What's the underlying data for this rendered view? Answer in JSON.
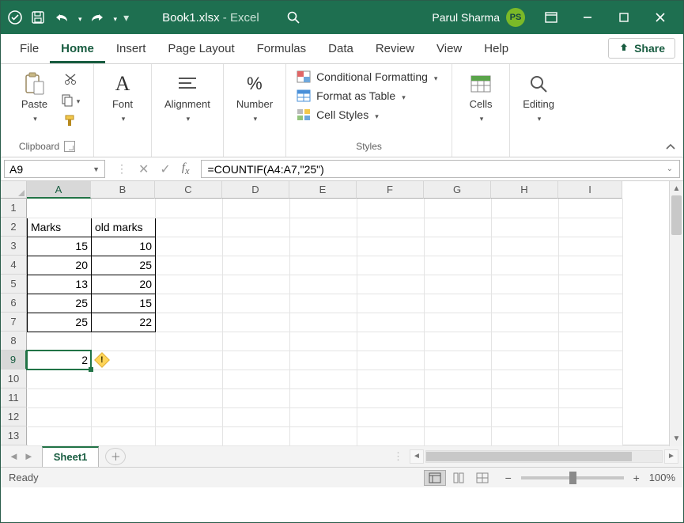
{
  "titlebar": {
    "filename": "Book1.xlsx",
    "app_suffix": " -  Excel",
    "user_name": "Parul Sharma",
    "user_initials": "PS"
  },
  "tabs": {
    "file": "File",
    "home": "Home",
    "insert": "Insert",
    "page_layout": "Page Layout",
    "formulas": "Formulas",
    "data": "Data",
    "review": "Review",
    "view": "View",
    "help": "Help",
    "share": "Share"
  },
  "ribbon": {
    "clipboard": {
      "label": "Clipboard",
      "paste": "Paste"
    },
    "font": {
      "label": "Font"
    },
    "alignment": {
      "label": "Alignment"
    },
    "number": {
      "label": "Number"
    },
    "styles": {
      "label": "Styles",
      "cond": "Conditional Formatting",
      "table": "Format as Table",
      "cell": "Cell Styles"
    },
    "cells": {
      "label": "Cells"
    },
    "editing": {
      "label": "Editing"
    }
  },
  "formula_bar": {
    "namebox": "A9",
    "formula": "=COUNTIF(A4:A7,\"25\")"
  },
  "grid": {
    "columns": [
      "A",
      "B",
      "C",
      "D",
      "E",
      "F",
      "G",
      "H",
      "I"
    ],
    "row_count": 13,
    "selected_col_index": 0,
    "selected_row_index": 8,
    "data_block": {
      "top_row": 2,
      "left_col": 0,
      "headers": [
        "Marks",
        "old marks"
      ],
      "rows": [
        [
          15,
          10
        ],
        [
          20,
          25
        ],
        [
          13,
          20
        ],
        [
          25,
          15
        ],
        [
          25,
          22
        ]
      ]
    },
    "result": {
      "row": 9,
      "col": 0,
      "value": 2
    }
  },
  "sheets": {
    "active": "Sheet1"
  },
  "statusbar": {
    "mode": "Ready",
    "zoom": "100%"
  },
  "chart_data": {
    "type": "table",
    "headers": [
      "Marks",
      "old marks"
    ],
    "rows": [
      [
        15,
        10
      ],
      [
        20,
        25
      ],
      [
        13,
        20
      ],
      [
        25,
        15
      ],
      [
        25,
        22
      ]
    ],
    "derived": {
      "cell_formula": "=COUNTIF(A4:A7,\"25\")",
      "cell_value": 2
    }
  }
}
